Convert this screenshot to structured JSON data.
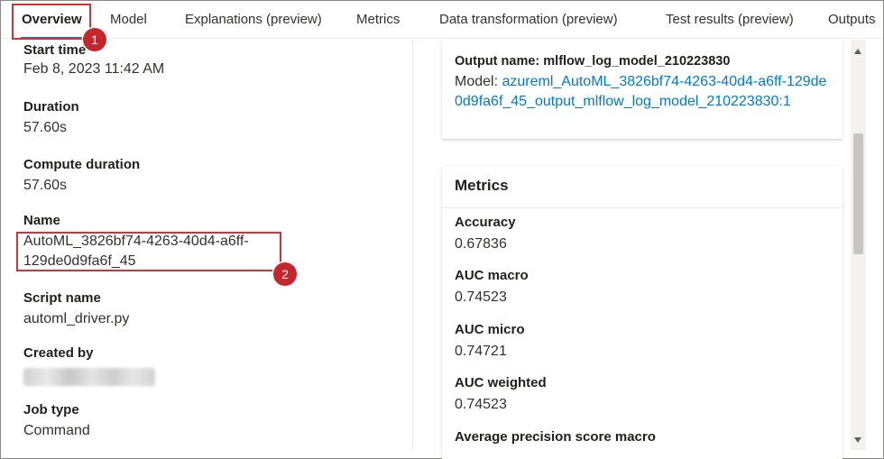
{
  "tabs": [
    {
      "label": "Overview"
    },
    {
      "label": "Model"
    },
    {
      "label": "Explanations (preview)"
    },
    {
      "label": "Metrics"
    },
    {
      "label": "Data transformation (preview)"
    },
    {
      "label": "Test results (preview)"
    },
    {
      "label": "Outputs"
    }
  ],
  "callouts": {
    "one": "1",
    "two": "2"
  },
  "details": {
    "start_time": {
      "label": "Start time",
      "value": "Feb 8, 2023 11:42 AM"
    },
    "duration": {
      "label": "Duration",
      "value": "57.60s"
    },
    "compute_duration": {
      "label": "Compute duration",
      "value": "57.60s"
    },
    "name": {
      "label": "Name",
      "value": "AutoML_3826bf74-4263-40d4-a6ff-129de0d9fa6f_45"
    },
    "script_name": {
      "label": "Script name",
      "value": "automl_driver.py"
    },
    "created_by": {
      "label": "Created by"
    },
    "job_type": {
      "label": "Job type",
      "value": "Command"
    }
  },
  "output": {
    "title": "Output name: mlflow_log_model_210223830",
    "model_prefix": "Model: ",
    "model_link": "azureml_AutoML_3826bf74-4263-40d4-a6ff-129de0d9fa6f_45_output_mlflow_log_model_210223830:1"
  },
  "metrics": {
    "title": "Metrics",
    "items": [
      {
        "label": "Accuracy",
        "value": "0.67836"
      },
      {
        "label": "AUC macro",
        "value": "0.74523"
      },
      {
        "label": "AUC micro",
        "value": "0.74721"
      },
      {
        "label": "AUC weighted",
        "value": "0.74523"
      },
      {
        "label": "Average precision score macro",
        "value": ""
      }
    ]
  },
  "colors": {
    "accent": "#0078d4",
    "highlight": "#d13438",
    "badge": "#c4262e"
  }
}
